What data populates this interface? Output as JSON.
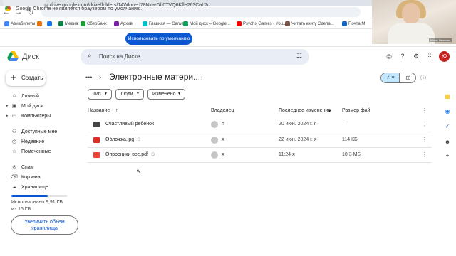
{
  "browser": {
    "url": "drive.google.com/drive/folders/14Wloned78Nka-Db0TVQ6Kfle263CaL7c",
    "bookmarks": [
      {
        "label": "Авиабилеты",
        "color": "#4285f4"
      },
      {
        "label": "",
        "color": "#e37400"
      },
      {
        "label": "",
        "color": "#1a73e8"
      },
      {
        "label": "Медиа",
        "color": "#0b8043"
      },
      {
        "label": "СберБанк",
        "color": "#21a038"
      },
      {
        "label": "Архив",
        "color": "#7b1fa2"
      },
      {
        "label": "Главная — Canva",
        "color": "#00c4cc"
      },
      {
        "label": "Мой диск – Google...",
        "color": "#0f9d58"
      },
      {
        "label": "Psycho Games - You...",
        "color": "#ff0000"
      },
      {
        "label": "Читать книгу Сдела...",
        "color": "#795548"
      },
      {
        "label": "Почта М",
        "color": "#1565c0"
      }
    ],
    "infobar_text": "Google Chrome не является браузером по умолчанию.",
    "default_button": "Использовать по умолчанию"
  },
  "webcam": {
    "name_tag": "Юлия Иванова"
  },
  "header": {
    "app_title": "Диск",
    "search_placeholder": "Поиск на Диске",
    "avatar_letter": "Ю",
    "avatar_color": "#c5221f"
  },
  "sidebar": {
    "new_label": "Создать",
    "items": [
      {
        "label": "Личный",
        "icon": "home-icon"
      },
      {
        "label": "Мой диск",
        "icon": "my-drive-icon"
      },
      {
        "label": "Компьютеры",
        "icon": "computer-icon"
      },
      {
        "label": "Доступные мне",
        "icon": "shared-icon"
      },
      {
        "label": "Недавние",
        "icon": "clock-icon"
      },
      {
        "label": "Помеченные",
        "icon": "star-icon"
      },
      {
        "label": "Спам",
        "icon": "spam-icon"
      },
      {
        "label": "Корзина",
        "icon": "trash-icon"
      },
      {
        "label": "Хранилище",
        "icon": "cloud-icon"
      }
    ],
    "storage_used_fraction": 0.66,
    "storage_text": "Использовано 9,91 ГБ из 15 ГБ",
    "upgrade_label": "Увеличить объем хранилища"
  },
  "main": {
    "folder_title": "Электронные матери...",
    "filters": [
      "Тип",
      "Люди",
      "Изменено"
    ],
    "columns": {
      "name": "Название",
      "owner": "Владелец",
      "modified": "Последнее изменение",
      "size": "Размер фай"
    },
    "files": [
      {
        "name": "Счастливый ребенок",
        "type": "folder",
        "icon_color": "#444746",
        "shared": false,
        "owner": "я",
        "modified": "20 июн. 2024 г. я",
        "size": "—"
      },
      {
        "name": "Обложка.jpg",
        "type": "image",
        "icon_color": "#d93025",
        "shared": true,
        "owner": "я",
        "modified": "22 июн. 2024 г. я",
        "size": "114 КБ"
      },
      {
        "name": "Опросники все.pdf",
        "type": "pdf",
        "icon_color": "#ea4335",
        "shared": true,
        "owner": "я",
        "modified": "11:24 я",
        "size": "10,3 МБ"
      }
    ]
  }
}
